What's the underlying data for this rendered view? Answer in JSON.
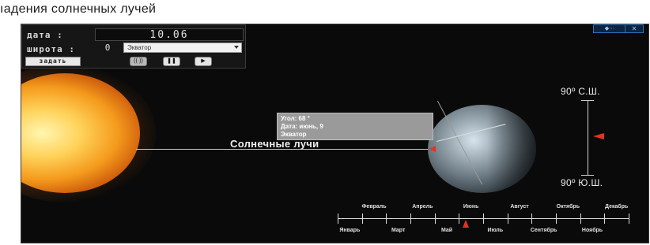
{
  "page": {
    "title": "ıадения солнечных лучей"
  },
  "controls": {
    "date_label": "дата :",
    "date_value": "10.06",
    "latitude_label": "широта :",
    "latitude_value": "0",
    "latitude_select": "Экватор",
    "set_button": "задать",
    "stop_glyph": "((·))",
    "pause_glyph": "❚❚",
    "play_glyph": "▶"
  },
  "window_buttons": {
    "back": "◆···",
    "close": "✕"
  },
  "scene": {
    "ray_label": "Солнечные лучи",
    "tooltip": {
      "angle": "Угол: 68 °",
      "date": "Дата: июнь, 9",
      "place": "Экватор"
    },
    "lat_north": "90º С.Ш.",
    "lat_south": "90º Ю.Ш.",
    "latitude_pointer_fraction": 0.5
  },
  "timeline": {
    "upper_months": [
      "Февраль",
      "Апрель",
      "Июнь",
      "Август",
      "Октябрь",
      "Декабрь"
    ],
    "lower_months": [
      "Январь",
      "Март",
      "Май",
      "Июль",
      "Сентябрь",
      "Ноябрь"
    ],
    "selected_month_fraction": 0.44
  },
  "colors": {
    "marker": "#e5331c",
    "background": "#0a0a0a"
  }
}
